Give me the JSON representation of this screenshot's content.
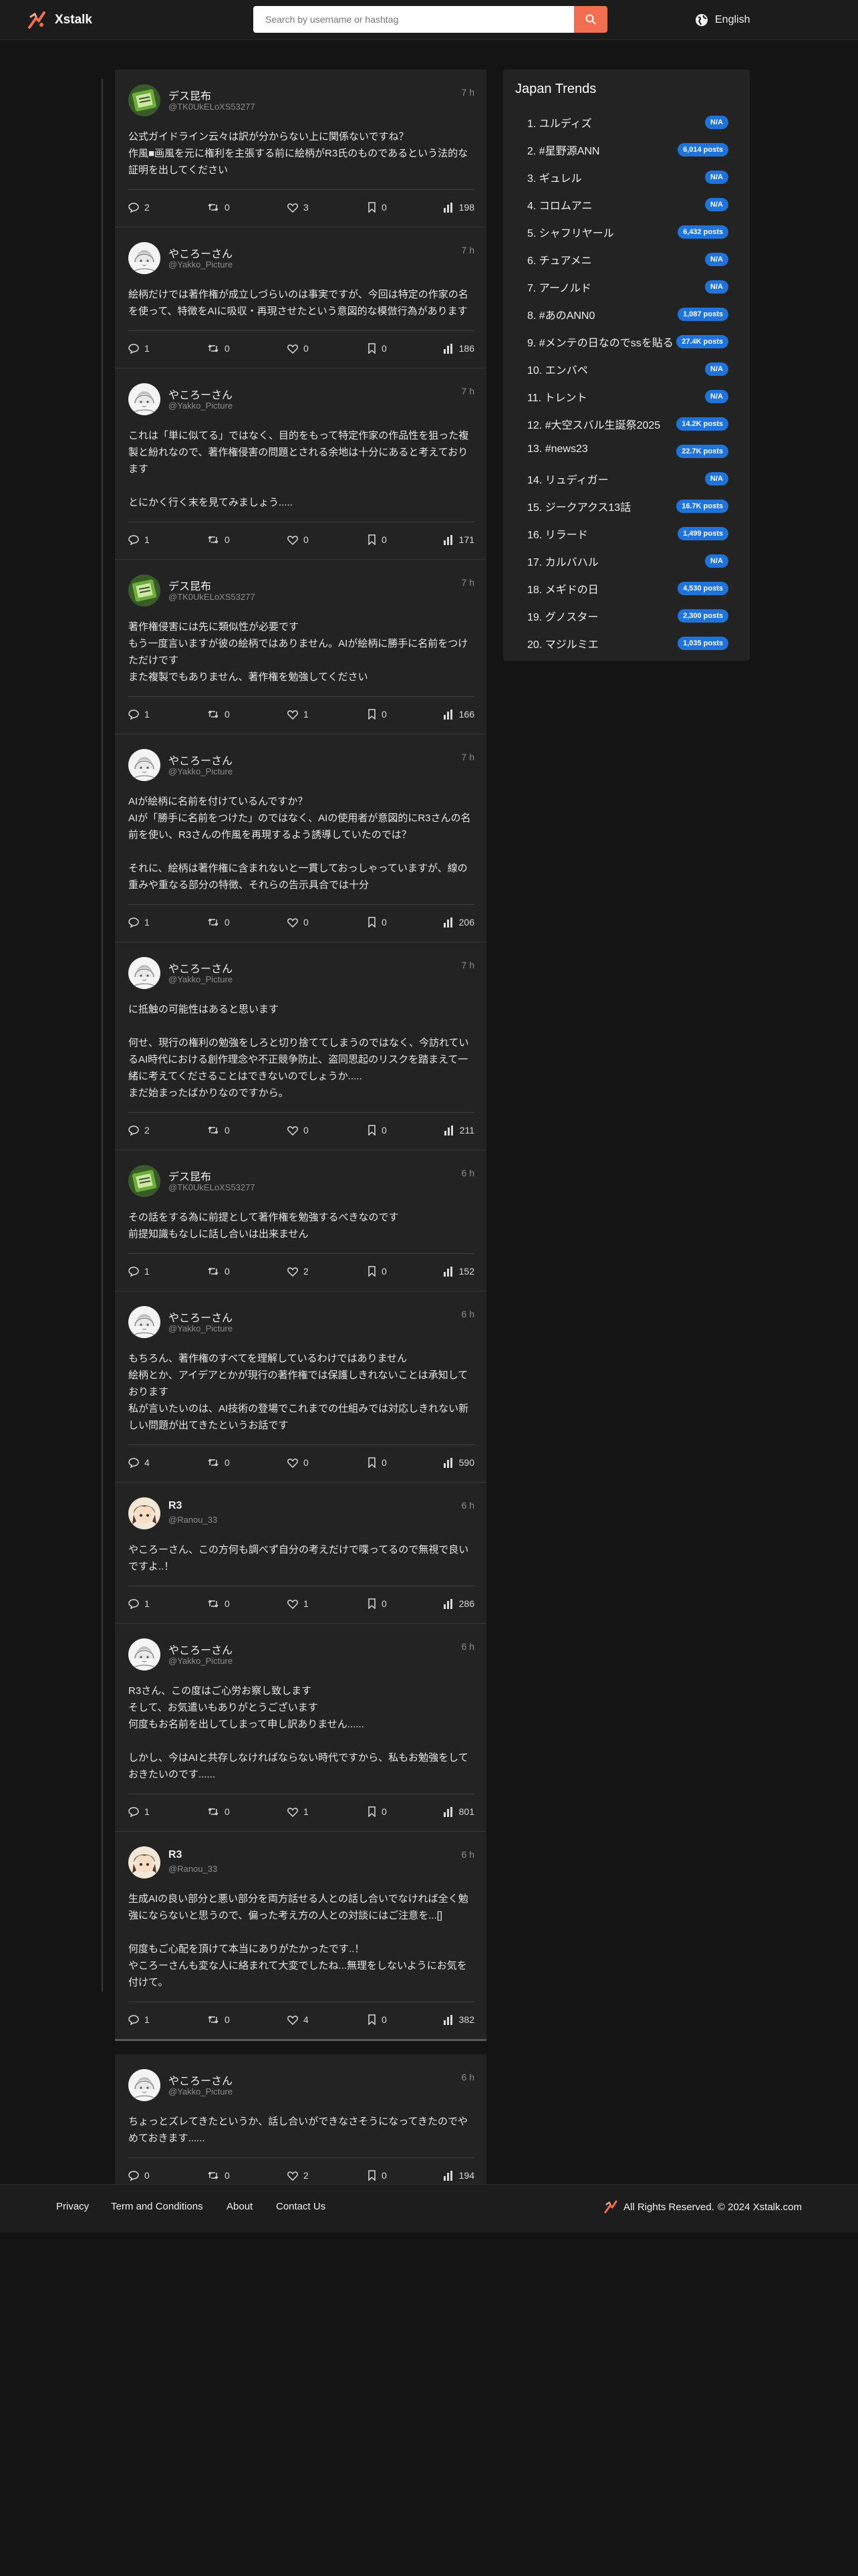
{
  "header": {
    "brand": "Xstalk",
    "search_placeholder": "Search by username or hashtag",
    "language": "English"
  },
  "posts": [
    {
      "name": "デス昆布",
      "handle": "@TK0UkELoXS53277",
      "time": "7 h",
      "text": "公式ガイドライン云々は訳が分からない上に関係ないですね？\n作風■画風を元に権利を主張する前に絵柄がR3氏のものであるという法的な証明を出してください",
      "replies": "2",
      "reposts": "0",
      "likes": "3",
      "bookmarks": "0",
      "views": "198"
    },
    {
      "name": "やころーさん",
      "handle": "@Yakko_Picture",
      "time": "7 h",
      "text": "絵柄だけでは著作権が成立しづらいのは事実ですが、今回は特定の作家の名を使って、特徴をAIに吸収・再現させたという意図的な模倣行為があります",
      "replies": "1",
      "reposts": "0",
      "likes": "0",
      "bookmarks": "0",
      "views": "186"
    },
    {
      "name": "やころーさん",
      "handle": "@Yakko_Picture",
      "time": "7 h",
      "text": "これは「単に似てる」ではなく、目的をもって特定作家の作品性を狙った複製と紛れなので、著作権侵害の問題とされる余地は十分にあると考えております\n\nとにかく行く末を見てみましょう.....",
      "replies": "1",
      "reposts": "0",
      "likes": "0",
      "bookmarks": "0",
      "views": "171"
    },
    {
      "name": "デス昆布",
      "handle": "@TK0UkELoXS53277",
      "time": "7 h",
      "text": "著作権侵害には先に類似性が必要です\nもう一度言いますが彼の絵柄ではありません。AIが絵柄に勝手に名前をつけただけです\nまた複製でもありません、著作権を勉強してください",
      "replies": "1",
      "reposts": "0",
      "likes": "1",
      "bookmarks": "0",
      "views": "166"
    },
    {
      "name": "やころーさん",
      "handle": "@Yakko_Picture",
      "time": "7 h",
      "text": "AIが絵柄に名前を付けているんですか？\nAIが「勝手に名前をつけた」のではなく、AIの使用者が意図的にR3さんの名前を使い、R3さんの作風を再現するよう誘導していたのでは？\n\nそれに、絵柄は著作権に含まれないと一貫しておっしゃっていますが、線の重みや重なる部分の特徴、それらの告示具合では十分",
      "replies": "1",
      "reposts": "0",
      "likes": "0",
      "bookmarks": "0",
      "views": "206"
    },
    {
      "name": "やころーさん",
      "handle": "@Yakko_Picture",
      "time": "7 h",
      "text": "に抵触の可能性はあると思います\n\n何せ、現行の権利の勉強をしろと切り捨ててしまうのではなく、今訪れているAI時代における創作理念や不正競争防止、盗同思起のリスクを踏まえて一緒に考えてくださることはできないのでしょうか.....\nまだ始まったばかりなのですから。",
      "replies": "2",
      "reposts": "0",
      "likes": "0",
      "bookmarks": "0",
      "views": "211"
    },
    {
      "name": "デス昆布",
      "handle": "@TK0UkELoXS53277",
      "time": "6 h",
      "text": "その話をする為に前提として著作権を勉強するべきなのです\n前提知識もなしに話し合いは出来ません",
      "replies": "1",
      "reposts": "0",
      "likes": "2",
      "bookmarks": "0",
      "views": "152"
    },
    {
      "name": "やころーさん",
      "handle": "@Yakko_Picture",
      "time": "6 h",
      "text": "もちろん、著作権のすべてを理解しているわけではありません\n絵柄とか、アイデアとかが現行の著作権では保護しきれないことは承知しております\n私が言いたいのは、AI技術の登場でこれまでの仕組みでは対応しきれない新しい問題が出てきたというお話です",
      "replies": "4",
      "reposts": "0",
      "likes": "0",
      "bookmarks": "0",
      "views": "590"
    },
    {
      "name": "R3",
      "handle": "@Ranou_33",
      "time": "6 h",
      "text": "やころーさん、この方何も調べず自分の考えだけで喋ってるので無視で良いですよ..！",
      "replies": "1",
      "reposts": "0",
      "likes": "1",
      "bookmarks": "0",
      "views": "286"
    },
    {
      "name": "やころーさん",
      "handle": "@Yakko_Picture",
      "time": "6 h",
      "text": "R3さん、この度はご心労お察し致します\nそして、お気遣いもありがとうございます\n何度もお名前を出してしまって申し訳ありません......\n\nしかし、今はAIと共存しなければならない時代ですから、私もお勉強をしておきたいのです......",
      "replies": "1",
      "reposts": "0",
      "likes": "1",
      "bookmarks": "0",
      "views": "801"
    },
    {
      "name": "R3",
      "handle": "@Ranou_33",
      "time": "6 h",
      "text": "生成AIの良い部分と悪い部分を両方話せる人との話し合いでなければ全く勉強にならないと思うので、偏った考え方の人との対談にはご注意を...[]\n\n何度もご心配を頂けて本当にありがたかったです..！\nやころーさんも変な人に絡まれて大変でしたね...無理をしないようにお気を付けて。",
      "replies": "1",
      "reposts": "0",
      "likes": "4",
      "bookmarks": "0",
      "views": "382"
    },
    {
      "name": "やころーさん",
      "handle": "@Yakko_Picture",
      "time": "6 h",
      "text": "ちょっとズレてきたというか、話し合いができなさそうになってきたのでやめておきます......",
      "replies": "0",
      "reposts": "0",
      "likes": "2",
      "bookmarks": "0",
      "views": "194"
    }
  ],
  "trends": {
    "title": "Japan Trends",
    "items": [
      {
        "name": "1. ユルディズ",
        "count": "N/A"
      },
      {
        "name": "2. #星野源ANN",
        "count": "6,014 posts"
      },
      {
        "name": "3. ギュレル",
        "count": "N/A"
      },
      {
        "name": "4. コロムアニ",
        "count": "N/A"
      },
      {
        "name": "5. シャフリヤール",
        "count": "6,432 posts"
      },
      {
        "name": "6. チュアメニ",
        "count": "N/A"
      },
      {
        "name": "7. アーノルド",
        "count": "N/A"
      },
      {
        "name": "8. #あのANN0",
        "count": "1,087 posts"
      },
      {
        "name": "9. #メンテの日なのでssを貼る",
        "count": "27.4K posts"
      },
      {
        "name": "10. エンバペ",
        "count": "N/A"
      },
      {
        "name": "11. トレント",
        "count": "N/A"
      },
      {
        "name": "12. #大空スバル生誕祭2025",
        "count": "14.2K posts"
      },
      {
        "name": "13. #news23",
        "count": "22.7K posts"
      },
      {
        "name": "14. リュディガー",
        "count": "N/A"
      },
      {
        "name": "15. ジークアクス13話",
        "count": "16.7K posts"
      },
      {
        "name": "16. リラード",
        "count": "1,499 posts"
      },
      {
        "name": "17. カルバハル",
        "count": "N/A"
      },
      {
        "name": "18. メギドの日",
        "count": "4,530 posts"
      },
      {
        "name": "19. グノスター",
        "count": "2,300 posts"
      },
      {
        "name": "20. マジルミエ",
        "count": "1,035 posts"
      }
    ]
  },
  "footer": {
    "privacy": "Privacy",
    "terms": "Term and Conditions",
    "about": "About",
    "contact": "Contact Us",
    "rights": "All Rights Reserved.",
    "copyright": "© 2024 Xstalk.com"
  },
  "colors": {
    "accent": "#f26e50",
    "badge": "#1f73d9",
    "background": "#141414",
    "card": "#232323"
  }
}
